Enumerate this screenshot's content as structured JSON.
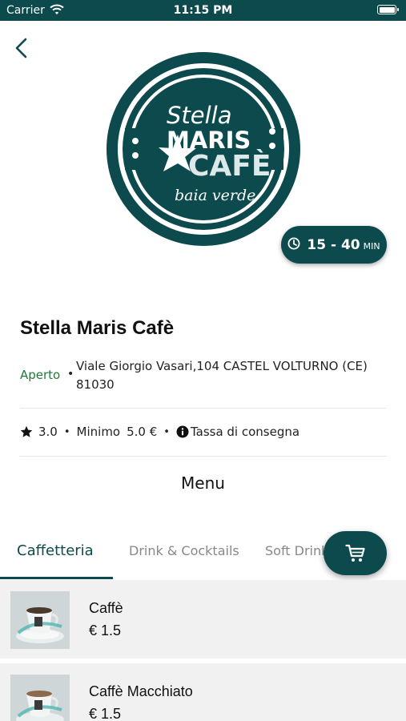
{
  "status_bar": {
    "carrier": "Carrier",
    "time": "11:15 PM"
  },
  "restaurant": {
    "logo_text": {
      "line1": "Stella",
      "line2": "MARIS",
      "line3": "CAFÈ",
      "line4": "baia verde"
    },
    "delivery_time": {
      "range": "15 - 40",
      "unit": "MIN"
    },
    "name": "Stella Maris Cafè",
    "status": "Aperto",
    "address": "Viale Giorgio Vasari,104 CASTEL VOLTURNO (CE) 81030",
    "rating": "3.0",
    "minimum_label": "Minimo",
    "minimum_value": "5.0 €",
    "delivery_fee_label": "Tassa di consegna"
  },
  "menu_heading": "Menu",
  "tabs": [
    {
      "label": "Caffetteria",
      "active": true
    },
    {
      "label": "Drink & Cocktails",
      "active": false
    },
    {
      "label": "Soft Drink",
      "active": false
    }
  ],
  "items": [
    {
      "name": "Caffè",
      "price": "€ 1.5"
    },
    {
      "name": "Caffè Macchiato",
      "price": "€ 1.5"
    }
  ],
  "colors": {
    "brand": "#0d4a4e",
    "open_status": "#1f7a3a",
    "list_bg": "#f1f1f1"
  },
  "icons": [
    "wifi-icon",
    "battery-icon",
    "back-chevron-icon",
    "clock-icon",
    "star-icon",
    "info-icon",
    "cart-icon"
  ]
}
